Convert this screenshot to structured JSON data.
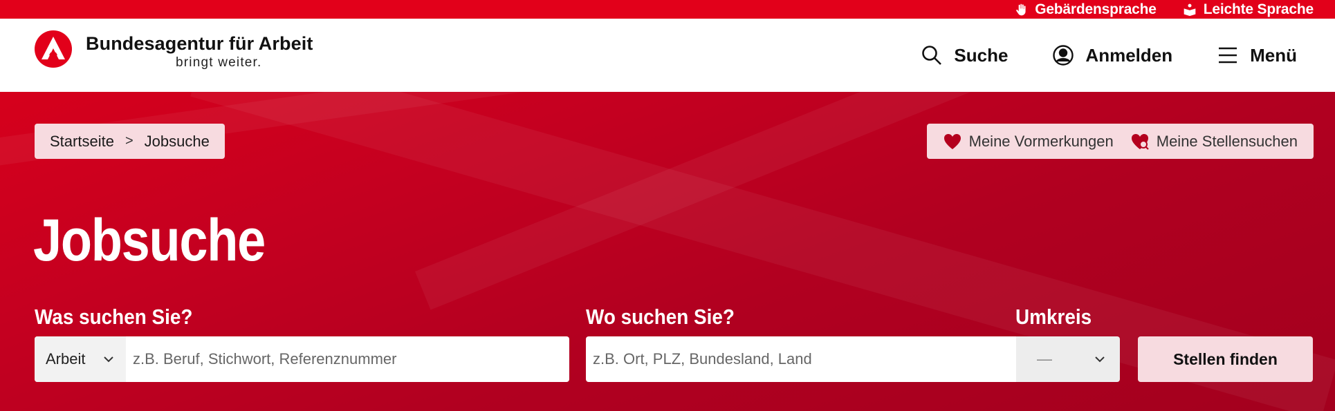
{
  "topbar": {
    "sign_language": "Gebärdensprache",
    "easy_language": "Leichte Sprache"
  },
  "logo": {
    "title": "Bundesagentur für Arbeit",
    "subtitle": "bringt weiter."
  },
  "nav": {
    "search": "Suche",
    "login": "Anmelden",
    "menu": "Menü"
  },
  "breadcrumb": {
    "home": "Startseite",
    "separator": ">",
    "current": "Jobsuche"
  },
  "quicklinks": {
    "bookmarks": "Meine Vormerkungen",
    "job_searches": "Meine Stellensuchen"
  },
  "page": {
    "title": "Jobsuche"
  },
  "search": {
    "what_label": "Was suchen Sie?",
    "type_select": "Arbeit",
    "what_placeholder": "z.B. Beruf, Stichwort, Referenznummer",
    "where_label": "Wo suchen Sie?",
    "where_placeholder": "z.B. Ort, PLZ, Bundesland, Land",
    "radius_label": "Umkreis",
    "radius_value": "—",
    "submit_label": "Stellen finden"
  },
  "colors": {
    "brand_red": "#e2001a",
    "hero_dark": "#a3001e",
    "pill_bg": "#f7dbe0"
  }
}
